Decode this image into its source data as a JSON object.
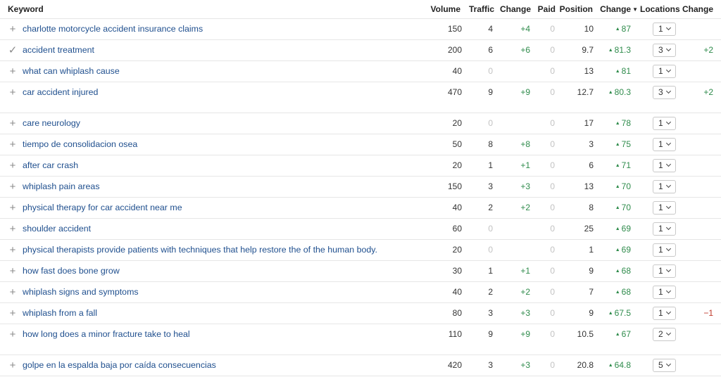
{
  "headers": {
    "keyword": "Keyword",
    "volume": "Volume",
    "traffic": "Traffic",
    "change": "Change",
    "paid": "Paid",
    "position": "Position",
    "position_change": "Change",
    "locations": "Locations",
    "locations_change": "Change",
    "sorted_column": "position_change",
    "sort_direction": "desc"
  },
  "colors": {
    "keyword_link": "#1f4f8e",
    "positive": "#2e8b4b",
    "negative": "#c0392b",
    "muted": "#c2c2c2"
  },
  "rows": [
    {
      "icon": "plus-icon",
      "keyword": "charlotte motorcycle accident insurance claims",
      "volume": "150",
      "traffic": "4",
      "traffic_muted": false,
      "change": "+4",
      "paid": "0",
      "position": "10",
      "position_change": "87",
      "locations": "1",
      "locations_change": "",
      "tall": false
    },
    {
      "icon": "check-icon",
      "keyword": "accident treatment",
      "volume": "200",
      "traffic": "6",
      "traffic_muted": false,
      "change": "+6",
      "paid": "0",
      "position": "9.7",
      "position_change": "81.3",
      "locations": "3",
      "locations_change": "+2",
      "tall": false
    },
    {
      "icon": "plus-icon",
      "keyword": "what can whiplash cause",
      "volume": "40",
      "traffic": "0",
      "traffic_muted": true,
      "change": "",
      "paid": "0",
      "position": "13",
      "position_change": "81",
      "locations": "1",
      "locations_change": "",
      "tall": false
    },
    {
      "icon": "plus-icon",
      "keyword": "car accident injured",
      "volume": "470",
      "traffic": "9",
      "traffic_muted": false,
      "change": "+9",
      "paid": "0",
      "position": "12.7",
      "position_change": "80.3",
      "locations": "3",
      "locations_change": "+2",
      "tall": true
    },
    {
      "icon": "plus-icon",
      "keyword": "care neurology",
      "volume": "20",
      "traffic": "0",
      "traffic_muted": true,
      "change": "",
      "paid": "0",
      "position": "17",
      "position_change": "78",
      "locations": "1",
      "locations_change": "",
      "tall": false
    },
    {
      "icon": "plus-icon",
      "keyword": "tiempo de consolidacion osea",
      "volume": "50",
      "traffic": "8",
      "traffic_muted": false,
      "change": "+8",
      "paid": "0",
      "position": "3",
      "position_change": "75",
      "locations": "1",
      "locations_change": "",
      "tall": false
    },
    {
      "icon": "plus-icon",
      "keyword": "after car crash",
      "volume": "20",
      "traffic": "1",
      "traffic_muted": false,
      "change": "+1",
      "paid": "0",
      "position": "6",
      "position_change": "71",
      "locations": "1",
      "locations_change": "",
      "tall": false
    },
    {
      "icon": "plus-icon",
      "keyword": "whiplash pain areas",
      "volume": "150",
      "traffic": "3",
      "traffic_muted": false,
      "change": "+3",
      "paid": "0",
      "position": "13",
      "position_change": "70",
      "locations": "1",
      "locations_change": "",
      "tall": false
    },
    {
      "icon": "plus-icon",
      "keyword": "physical therapy for car accident near me",
      "volume": "40",
      "traffic": "2",
      "traffic_muted": false,
      "change": "+2",
      "paid": "0",
      "position": "8",
      "position_change": "70",
      "locations": "1",
      "locations_change": "",
      "tall": false
    },
    {
      "icon": "plus-icon",
      "keyword": "shoulder accident",
      "volume": "60",
      "traffic": "0",
      "traffic_muted": true,
      "change": "",
      "paid": "0",
      "position": "25",
      "position_change": "69",
      "locations": "1",
      "locations_change": "",
      "tall": false
    },
    {
      "icon": "plus-icon",
      "keyword": "physical therapists provide patients with techniques that help restore the of the human body.",
      "volume": "20",
      "traffic": "0",
      "traffic_muted": true,
      "change": "",
      "paid": "0",
      "position": "1",
      "position_change": "69",
      "locations": "1",
      "locations_change": "",
      "tall": false
    },
    {
      "icon": "plus-icon",
      "keyword": "how fast does bone grow",
      "volume": "30",
      "traffic": "1",
      "traffic_muted": false,
      "change": "+1",
      "paid": "0",
      "position": "9",
      "position_change": "68",
      "locations": "1",
      "locations_change": "",
      "tall": false
    },
    {
      "icon": "plus-icon",
      "keyword": "whiplash signs and symptoms",
      "volume": "40",
      "traffic": "2",
      "traffic_muted": false,
      "change": "+2",
      "paid": "0",
      "position": "7",
      "position_change": "68",
      "locations": "1",
      "locations_change": "",
      "tall": false
    },
    {
      "icon": "plus-icon",
      "keyword": "whiplash from a fall",
      "volume": "80",
      "traffic": "3",
      "traffic_muted": false,
      "change": "+3",
      "paid": "0",
      "position": "9",
      "position_change": "67.5",
      "locations": "1",
      "locations_change": "−1",
      "tall": false
    },
    {
      "icon": "plus-icon",
      "keyword": "how long does a minor fracture take to heal",
      "volume": "110",
      "traffic": "9",
      "traffic_muted": false,
      "change": "+9",
      "paid": "0",
      "position": "10.5",
      "position_change": "67",
      "locations": "2",
      "locations_change": "",
      "tall": true
    },
    {
      "icon": "plus-icon",
      "keyword": "golpe en la espalda baja por caída consecuencias",
      "volume": "420",
      "traffic": "3",
      "traffic_muted": false,
      "change": "+3",
      "paid": "0",
      "position": "20.8",
      "position_change": "64.8",
      "locations": "5",
      "locations_change": "",
      "tall": false
    }
  ]
}
